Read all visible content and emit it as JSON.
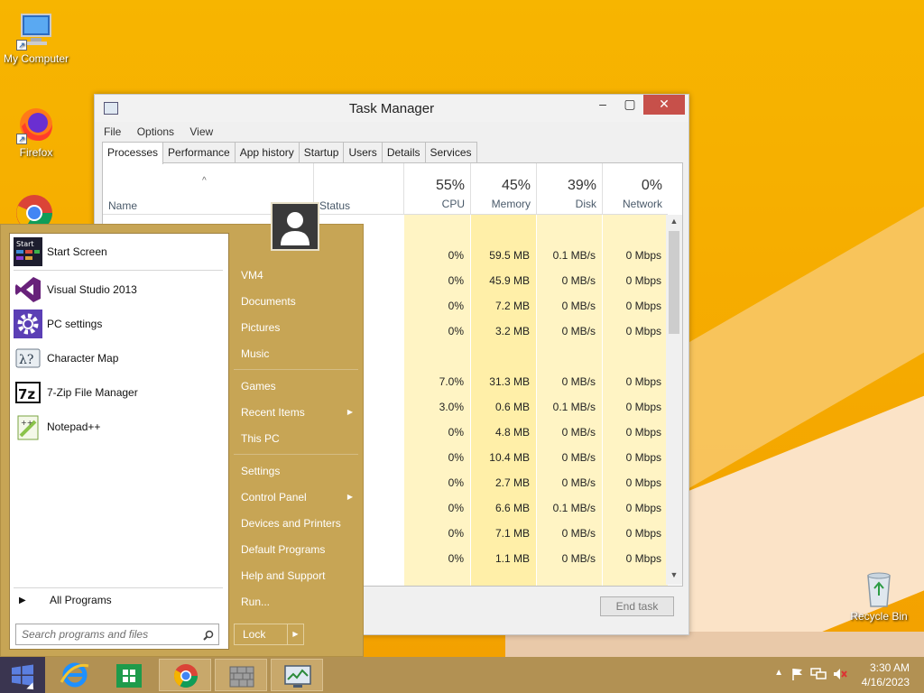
{
  "desktop": {
    "icons": [
      {
        "label": "My Computer",
        "icon": "computer-icon"
      },
      {
        "label": "Firefox",
        "icon": "firefox-icon"
      },
      {
        "label": "Recycle Bin",
        "icon": "recycle-bin-icon"
      }
    ]
  },
  "task_manager": {
    "title": "Task Manager",
    "menu": [
      "File",
      "Options",
      "View"
    ],
    "tabs": [
      "Processes",
      "Performance",
      "App history",
      "Startup",
      "Users",
      "Details",
      "Services"
    ],
    "active_tab": "Processes",
    "columns": {
      "name": "Name",
      "status": "Status",
      "cpu": {
        "pct": "55%",
        "label": "CPU"
      },
      "memory": {
        "pct": "45%",
        "label": "Memory"
      },
      "disk": {
        "pct": "39%",
        "label": "Disk"
      },
      "network": {
        "pct": "0%",
        "label": "Network"
      }
    },
    "rows": [
      {
        "cpu": "",
        "memory": "",
        "disk": "",
        "network": ""
      },
      {
        "cpu": "0%",
        "memory": "59.5 MB",
        "disk": "0.1 MB/s",
        "network": "0 Mbps"
      },
      {
        "cpu": "0%",
        "memory": "45.9 MB",
        "disk": "0 MB/s",
        "network": "0 Mbps"
      },
      {
        "cpu": "0%",
        "memory": "7.2 MB",
        "disk": "0 MB/s",
        "network": "0 Mbps"
      },
      {
        "cpu": "0%",
        "memory": "3.2 MB",
        "disk": "0 MB/s",
        "network": "0 Mbps"
      },
      {
        "cpu": "",
        "memory": "",
        "disk": "",
        "network": ""
      },
      {
        "cpu": "7.0%",
        "memory": "31.3 MB",
        "disk": "0 MB/s",
        "network": "0 Mbps"
      },
      {
        "cpu": "3.0%",
        "memory": "0.6 MB",
        "disk": "0.1 MB/s",
        "network": "0 Mbps"
      },
      {
        "cpu": "0%",
        "memory": "4.8 MB",
        "disk": "0 MB/s",
        "network": "0 Mbps"
      },
      {
        "cpu": "0%",
        "memory": "10.4 MB",
        "disk": "0 MB/s",
        "network": "0 Mbps"
      },
      {
        "cpu": "0%",
        "memory": "2.7 MB",
        "disk": "0 MB/s",
        "network": "0 Mbps"
      },
      {
        "cpu": "0%",
        "memory": "6.6 MB",
        "disk": "0.1 MB/s",
        "network": "0 Mbps"
      },
      {
        "cpu": "0%",
        "memory": "7.1 MB",
        "disk": "0 MB/s",
        "network": "0 Mbps"
      },
      {
        "cpu": "0%",
        "memory": "1.1 MB",
        "disk": "0 MB/s",
        "network": "0 Mbps"
      }
    ],
    "end_task": "End task"
  },
  "start_menu": {
    "left_items": [
      {
        "label": "Start Screen",
        "icon": "start-screen-icon"
      },
      {
        "label": "Visual Studio 2013",
        "icon": "visual-studio-icon"
      },
      {
        "label": "PC settings",
        "icon": "gear-icon"
      },
      {
        "label": "Character Map",
        "icon": "character-map-icon"
      },
      {
        "label": "7-Zip File Manager",
        "icon": "7zip-icon"
      },
      {
        "label": "Notepad++",
        "icon": "notepadpp-icon"
      }
    ],
    "all_programs": "All Programs",
    "search_placeholder": "Search programs and files",
    "right_items": [
      "VM4",
      "Documents",
      "Pictures",
      "Music",
      "Games",
      "Recent Items",
      "This PC",
      "Settings",
      "Control Panel",
      "Devices and Printers",
      "Default Programs",
      "Help and Support",
      "Run..."
    ],
    "lock": "Lock"
  },
  "taskbar": {
    "pinned": [
      "internet-explorer-icon",
      "store-icon",
      "chrome-icon",
      "firewall-icon",
      "task-manager-icon"
    ],
    "time": "3:30 AM",
    "date": "4/16/2023"
  }
}
